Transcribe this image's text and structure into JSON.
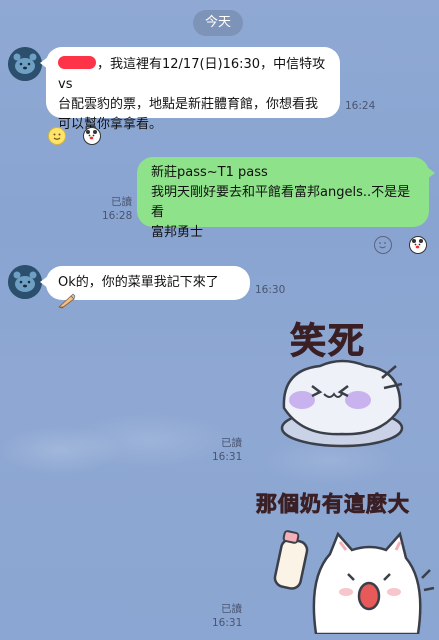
{
  "chat": {
    "date_label": "今天",
    "messages": [
      {
        "sender": "other",
        "text_after_redaction": "，我這裡有12/17(日)16:30，中信特攻vs",
        "line2": "台配雲豹的票，地點是新莊體育館，你想看我",
        "line3": "可以幫你拿拿看。",
        "time": "16:24"
      },
      {
        "sender": "me",
        "line1": "新莊pass~T1 pass",
        "line2": "我明天剛好要去和平館看富邦angels..不是是看",
        "line3": "富邦勇士",
        "read": "已讀",
        "time": "16:28"
      },
      {
        "sender": "other",
        "text": "Ok的，你的菜單我記下來了",
        "time": "16:30"
      },
      {
        "sender": "me",
        "type": "sticker",
        "sticker_text": "笑死",
        "read": "已讀",
        "time": "16:31"
      },
      {
        "sender": "me",
        "type": "sticker",
        "sticker_text": "那個奶有這麼大",
        "read": "已讀",
        "time": "16:31"
      }
    ]
  },
  "colors": {
    "background": "#8ba6d2",
    "outgoing_bubble": "#8ee28a",
    "incoming_bubble": "#ffffff",
    "redaction": "#ff3348"
  },
  "icons": [
    "bear-avatar-icon",
    "smile-reaction-icon",
    "bear-reaction-icon",
    "writing-hand-icon"
  ]
}
